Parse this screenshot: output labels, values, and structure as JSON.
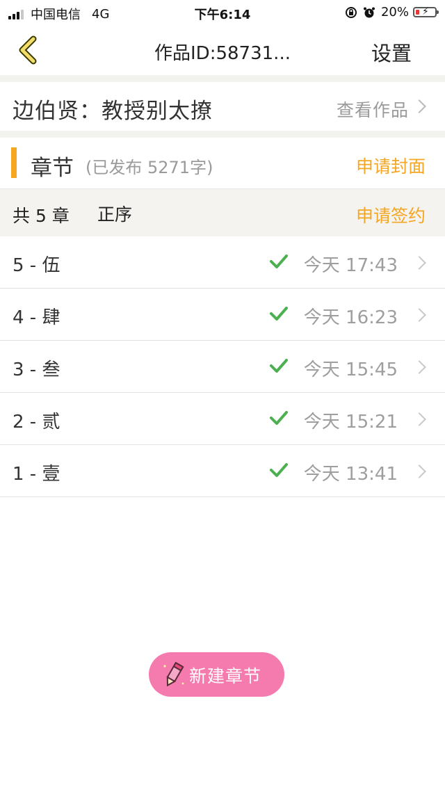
{
  "status_bar": {
    "carrier": "中国电信",
    "network": "4G",
    "time": "下午6:14",
    "battery": "20%",
    "battery_level": 0.2
  },
  "nav": {
    "back_icon": "chevron-left-icon",
    "title": "作品ID:58731...",
    "settings_label": "设置"
  },
  "work": {
    "title": "边伯贤：教授别太撩",
    "view_label": "查看作品"
  },
  "chapters_header": {
    "label": "章节",
    "published": "(已发布 5271字)",
    "apply_cover": "申请封面"
  },
  "meta": {
    "total": "共 5 章",
    "order": "正序",
    "apply_sign": "申请签约"
  },
  "chapters": [
    {
      "title": "5 - 伍",
      "time": "今天 17:43",
      "published": true
    },
    {
      "title": "4 - 肆",
      "time": "今天 16:23",
      "published": true
    },
    {
      "title": "3 - 叁",
      "time": "今天 15:45",
      "published": true
    },
    {
      "title": "2 - 贰",
      "time": "今天 15:21",
      "published": true
    },
    {
      "title": "1 - 壹",
      "time": "今天 13:41",
      "published": true
    }
  ],
  "new_chapter_button": {
    "label": "新建章节",
    "icon": "pencil-icon"
  },
  "colors": {
    "accent": "#f5a623",
    "button_pink": "#f57aae",
    "check_green": "#4caf50"
  }
}
